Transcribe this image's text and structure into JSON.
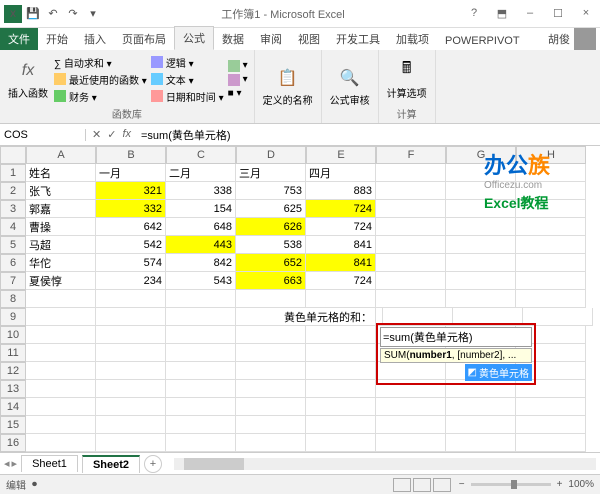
{
  "title": "工作簿1 - Microsoft Excel",
  "tabs": {
    "file": "文件",
    "home": "开始",
    "insert": "插入",
    "layout": "页面布局",
    "formulas": "公式",
    "data": "数据",
    "review": "审阅",
    "view": "视图",
    "dev": "开发工具",
    "addins": "加载项",
    "powerpivot": "POWERPIVOT"
  },
  "user": "胡俊",
  "ribbon": {
    "insertfn": "插入函数",
    "lib": {
      "autosum": "∑ 自动求和 ▾",
      "recent": "最近使用的函数 ▾",
      "financial": "财务 ▾",
      "logical": "逻辑 ▾",
      "text": "文本 ▾",
      "datetime": "日期和时间 ▾",
      "more": "■ ▾"
    },
    "libLabel": "函数库",
    "defined": "定义的名称",
    "audit": "公式审核",
    "calc": "计算选项",
    "calcLabel": "计算"
  },
  "namebox": "COS",
  "formula": "=sum(黄色单元格)",
  "cols": [
    "A",
    "B",
    "C",
    "D",
    "E",
    "F",
    "G",
    "H"
  ],
  "rows": [
    1,
    2,
    3,
    4,
    5,
    6,
    7,
    8,
    9,
    10,
    11,
    12,
    13,
    14,
    15,
    16
  ],
  "table": {
    "headers": [
      "姓名",
      "一月",
      "二月",
      "三月",
      "四月"
    ],
    "data": [
      {
        "name": "张飞",
        "v": [
          321,
          338,
          753,
          883
        ],
        "hl": [
          0
        ]
      },
      {
        "name": "郭嘉",
        "v": [
          332,
          154,
          625,
          724
        ],
        "hl": [
          0,
          3
        ]
      },
      {
        "name": "曹操",
        "v": [
          642,
          648,
          626,
          724
        ],
        "hl": [
          2
        ]
      },
      {
        "name": "马超",
        "v": [
          542,
          443,
          538,
          841
        ],
        "hl": [
          1
        ]
      },
      {
        "name": "华佗",
        "v": [
          574,
          842,
          652,
          841
        ],
        "hl": [
          2,
          3
        ]
      },
      {
        "name": "夏侯惇",
        "v": [
          234,
          543,
          663,
          724
        ],
        "hl": [
          2
        ]
      }
    ]
  },
  "label9": "黄色单元格的和：",
  "edit": {
    "text": "=sum(黄色单元格)",
    "tip": "SUM(number1, [number2], ...",
    "tipBold": "number1",
    "item": "黄色单元格"
  },
  "branding": {
    "t1a": "办公",
    "t1b": "族",
    "t2": "Officezu.com",
    "t3": "Excel教程"
  },
  "sheets": {
    "s1": "Sheet1",
    "s2": "Sheet2"
  },
  "status": {
    "mode": "编辑",
    "zoom": "100%"
  }
}
